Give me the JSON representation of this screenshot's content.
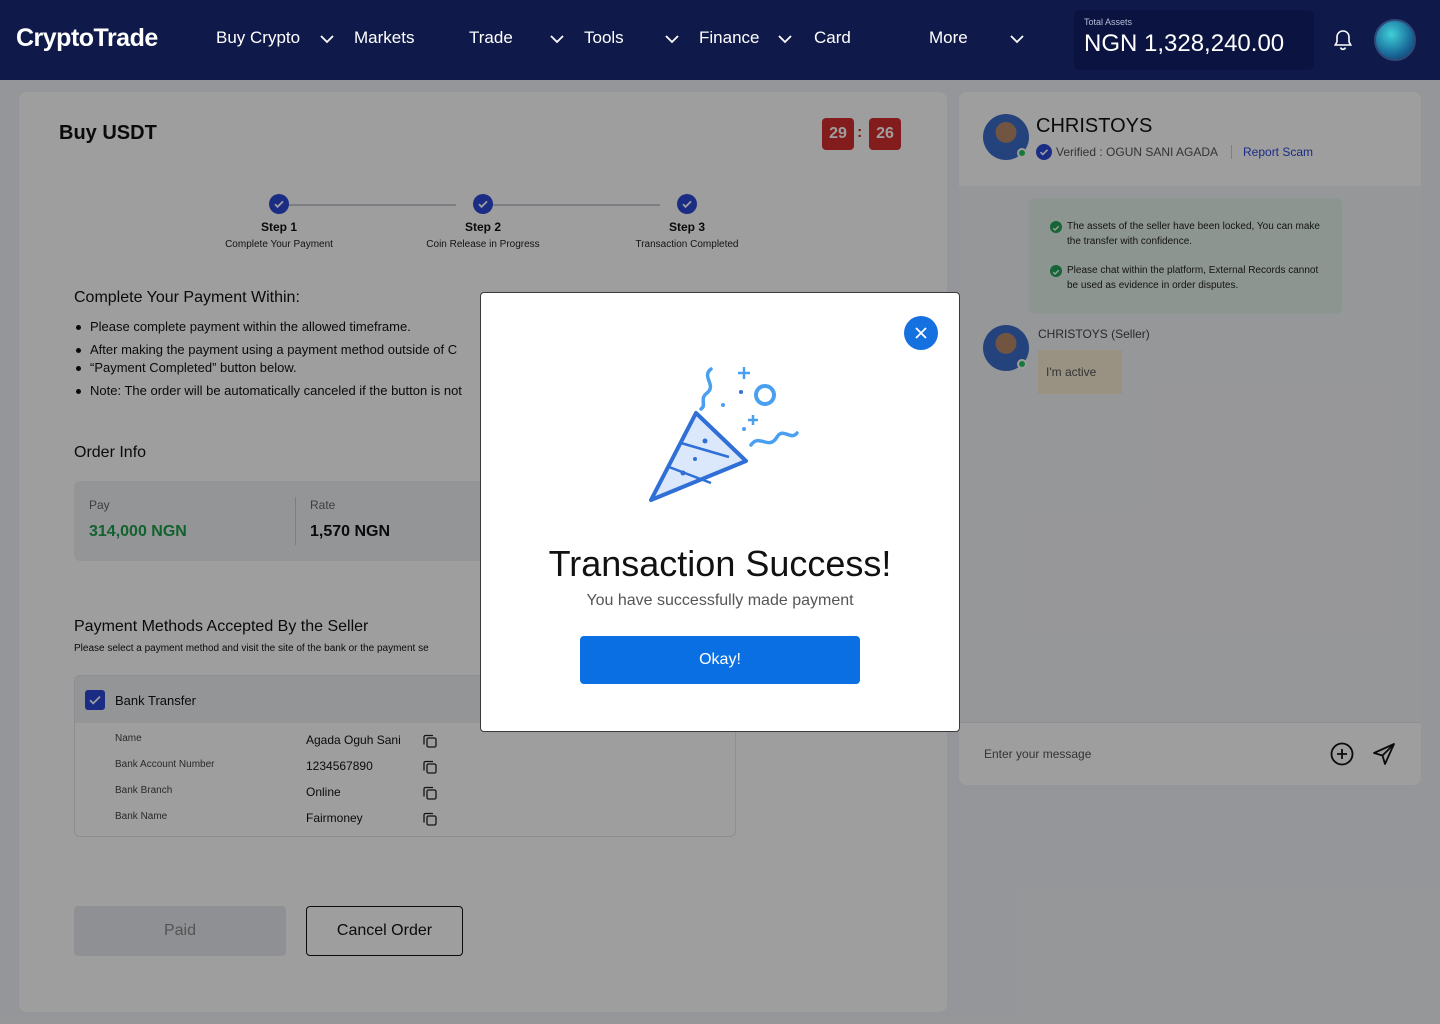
{
  "nav": {
    "logo": "CryptoTrade",
    "items": [
      {
        "label": "Buy Crypto",
        "has_dropdown": true
      },
      {
        "label": "Markets",
        "has_dropdown": false
      },
      {
        "label": "Trade",
        "has_dropdown": true
      },
      {
        "label": "Tools",
        "has_dropdown": true
      },
      {
        "label": "Finance",
        "has_dropdown": true
      },
      {
        "label": "Card",
        "has_dropdown": false
      },
      {
        "label": "More",
        "has_dropdown": true
      }
    ],
    "assets_label": "Total Assets",
    "assets_value": "NGN 1,328,240.00",
    "icons": [
      "bell-icon",
      "avatar"
    ]
  },
  "order": {
    "title": "Buy USDT",
    "timer": {
      "minutes": "29",
      "separator": ":",
      "seconds": "26"
    },
    "steps": [
      {
        "title": "Step 1",
        "subtitle": "Complete Your Payment"
      },
      {
        "title": "Step 2",
        "subtitle": "Coin Release in Progress"
      },
      {
        "title": "Step 3",
        "subtitle": "Transaction Completed"
      }
    ],
    "payment_heading": "Complete Your Payment Within:",
    "bullets": [
      "Please complete payment within the allowed timeframe.",
      "After making the payment using a payment method outside of C",
      "“Payment Completed” button below.",
      "Note: The order will be automatically canceled if the button is not"
    ],
    "order_info_heading": "Order Info",
    "pay_label": "Pay",
    "pay_value": "314,000 NGN",
    "rate_label": "Rate",
    "rate_value": "1,570 NGN",
    "methods_heading": "Payment Methods Accepted By the Seller",
    "methods_sub": "Please select a payment method and visit the site of the bank or the payment se",
    "method_title": "Bank Transfer",
    "fields": [
      {
        "label": "Name",
        "value": "Agada Oguh Sani"
      },
      {
        "label": "Bank Account Number",
        "value": "1234567890"
      },
      {
        "label": "Bank Branch",
        "value": "Online"
      },
      {
        "label": "Bank Name",
        "value": "Fairmoney"
      }
    ],
    "paid_label": "Paid",
    "cancel_label": "Cancel Order"
  },
  "chat": {
    "seller_name": "CHRISTOYS",
    "verified_text": "Verified : OGUN SANI AGADA",
    "report_label": "Report Scam",
    "notices": [
      "The assets of the seller have been locked, You can make the transfer with confidence.",
      "Please chat within the platform, External Records cannot be used as evidence in order disputes."
    ],
    "message_sender": "CHRISTOYS (Seller)",
    "message_text": "I'm active",
    "input_placeholder": "Enter your message"
  },
  "modal": {
    "title": "Transaction Success!",
    "subtitle": "You have successfully made payment",
    "button_label": "Okay!",
    "icon": "party-popper-icon"
  },
  "colors": {
    "nav_bg": "#101a4a",
    "accent_blue": "#2b47d6",
    "button_blue": "#0b6fe4",
    "timer_red": "#d32f2f",
    "pay_green": "#1e9e4a"
  }
}
